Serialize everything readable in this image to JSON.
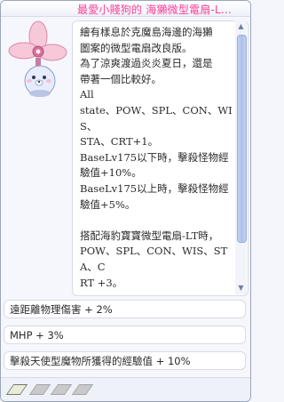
{
  "title": "最愛小賤狗的 海獺微型電扇-L...",
  "description": "繪有樣息於克魔島海邊的海獺\n圖案的微型電扇改良版。\n為了涼爽渡過炎炎夏日，還是\n帶著一個比較好。\nAll\nstate、POW、SPL、CON、WIS、\nSTA、CRT+1。\nBaseLv175以下時，擊殺怪物經\n驗值+10%。\nBaseLv175以上時，擊殺怪物經\n驗值+5%。\n\n搭配海豹寶寶微型電扇-LT時，\nPOW、SPL、CON、WIS、STA、C\nRT +3。",
  "bonuses": [
    "遠距離物理傷害 + 2%",
    "MHP + 3%",
    "擊殺天使型魔物所獲得的經驗值 + 10%"
  ],
  "slots": {
    "filled": 1,
    "empty": 3
  },
  "colors": {
    "title": "#ff3e9a",
    "accent": "#aac0ea"
  }
}
